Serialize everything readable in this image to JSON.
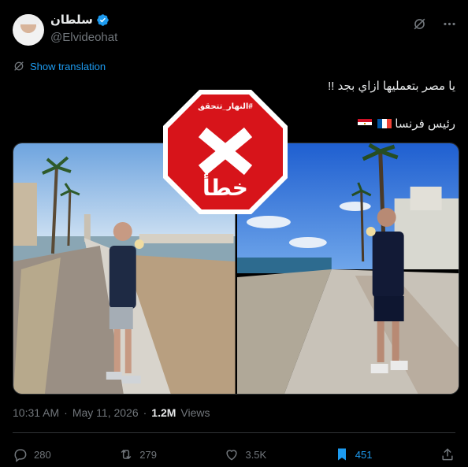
{
  "author": {
    "display_name": "سلطان",
    "handle": "@Elvideohat",
    "verified": true,
    "verified_color": "#1d9bf0"
  },
  "translate": {
    "label": "Show translation"
  },
  "tweet": {
    "line1": "يا مصر بتعمليها ازاي بجد !!",
    "line2": "رئيس فرنسا",
    "flags": [
      "france-flag",
      "egypt-flag"
    ]
  },
  "stamp": {
    "hashtag": "#النهار_تتحقق",
    "verdict": "خطأ",
    "color": "#d7141a"
  },
  "meta": {
    "time": "10:31 AM",
    "date": "May 11, 2026",
    "views_count": "1.2M",
    "views_label": "Views"
  },
  "actions": {
    "replies": "280",
    "reposts": "279",
    "likes": "3.5K",
    "bookmarks": "451"
  },
  "colors": {
    "accent": "#1d9bf0",
    "muted": "#71767b",
    "background": "#000000"
  }
}
